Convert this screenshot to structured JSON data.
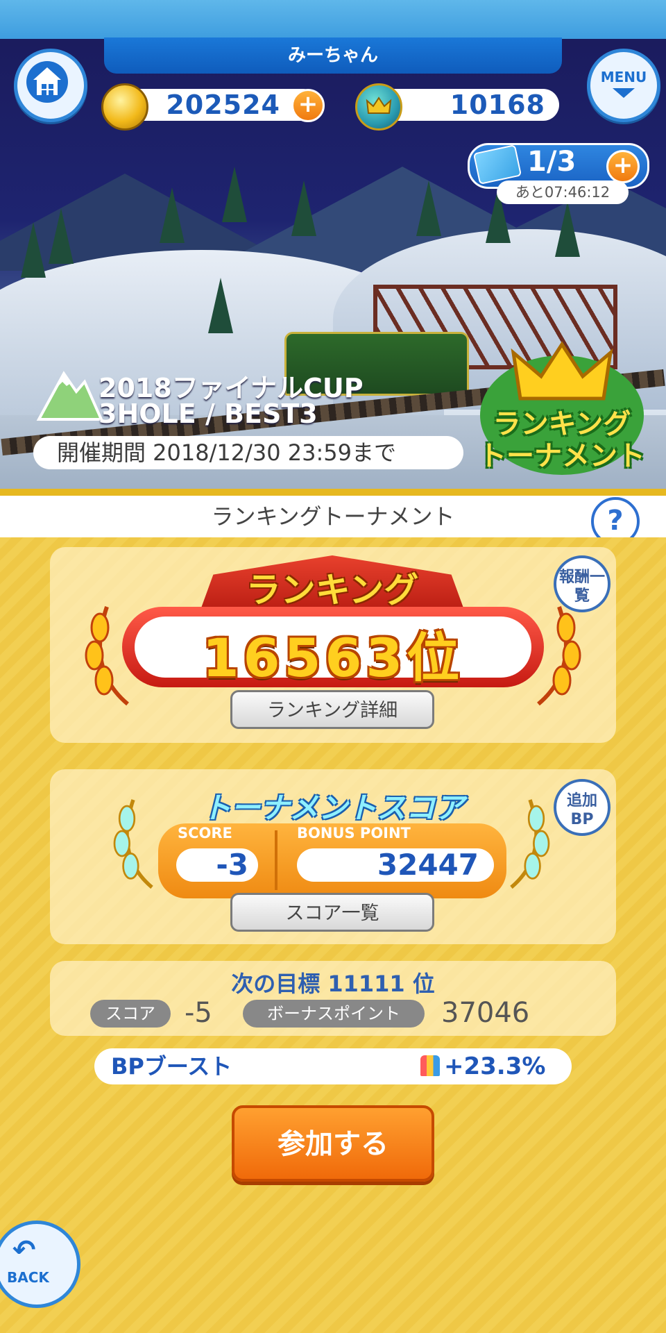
{
  "header": {
    "player_name": "みーちゃん",
    "menu_label": "MENU",
    "coins": "202524",
    "crowns": "10168",
    "tickets": "1/3",
    "ticket_timer": "あと07:46:12"
  },
  "event": {
    "title": "2018ファイナルCUP",
    "subtitle": "3HOLE / BEST3",
    "period": "開催期間 2018/12/30 23:59まで",
    "badge_line1": "ランキング",
    "badge_line2": "トーナメント"
  },
  "section": {
    "title": "ランキングトーナメント",
    "help": "?"
  },
  "ranking": {
    "ribbon": "ランキング",
    "rank": "16563位",
    "detail_button": "ランキング詳細",
    "reward_button": "報酬一覧"
  },
  "tournament_score": {
    "title": "トーナメントスコア",
    "score_label": "SCORE",
    "bonus_label": "BONUS POINT",
    "score": "-3",
    "bonus_point": "32447",
    "list_button": "スコア一覧",
    "add_bp_button": "追加BP"
  },
  "next_goal": {
    "text": "次の目標 11111 位",
    "score_tag": "スコア",
    "score": "-5",
    "bonus_tag": "ボーナスポイント",
    "bonus": "37046"
  },
  "boost": {
    "label": "BPブースト",
    "value": "+23.3%"
  },
  "join_button": "参加する",
  "back_label": "BACK",
  "colors": {
    "accent_blue": "#1c6fcf",
    "join_orange": "#f06a0a",
    "background_yellow": "#f2cf52"
  }
}
